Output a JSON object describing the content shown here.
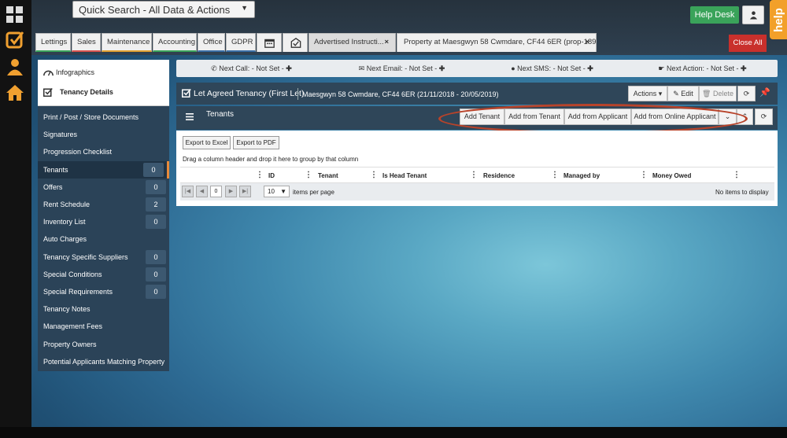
{
  "search": {
    "label": "Quick Search - All Data & Actions"
  },
  "header": {
    "help_desk": "Help Desk",
    "help_tab": "help"
  },
  "tabs": [
    "Lettings",
    "Sales",
    "Maintenance",
    "Accounting",
    "Office",
    "GDPR"
  ],
  "open_docs": [
    {
      "label": "Advertised Instructi..."
    },
    {
      "label": "Property at Maesgwyn 58 Cwmdare, CF44 6ER (prop-189)"
    }
  ],
  "close_all": "Close All",
  "sidebar": {
    "infographics": "Infographics",
    "tenancy_details": "Tenancy Details",
    "items": [
      {
        "label": "Print / Post / Store Documents",
        "count": ""
      },
      {
        "label": "Signatures",
        "count": ""
      },
      {
        "label": "Progression Checklist",
        "count": ""
      },
      {
        "label": "Tenants",
        "count": "0"
      },
      {
        "label": "Offers",
        "count": "0"
      },
      {
        "label": "Rent Schedule",
        "count": "2"
      },
      {
        "label": "Inventory List",
        "count": "0"
      },
      {
        "label": "Auto Charges",
        "count": ""
      },
      {
        "label": "Tenancy Specific Suppliers",
        "count": "0"
      },
      {
        "label": "Special Conditions",
        "count": "0"
      },
      {
        "label": "Special Requirements",
        "count": "0"
      },
      {
        "label": "Tenancy Notes",
        "count": ""
      },
      {
        "label": "Management Fees",
        "count": ""
      },
      {
        "label": "Property Owners",
        "count": ""
      },
      {
        "label": "Potential Applicants Matching Property",
        "count": ""
      }
    ]
  },
  "nextbar": {
    "call": "Next Call: - Not Set -",
    "email": "Next Email: - Not Set -",
    "sms": "Next SMS: - Not Set -",
    "action": "Next Action: - Not Set -"
  },
  "panel": {
    "title": "Let Agreed Tenancy (First Let)",
    "subtitle": "Maesgwyn 58 Cwmdare, CF44 6ER (21/11/2018 - 20/05/2019)",
    "actions": "Actions",
    "edit": "Edit",
    "delete": "Delete"
  },
  "tenants": {
    "title": "Tenants",
    "add_tenant": "Add Tenant",
    "add_from_tenant": "Add from Tenant",
    "add_from_applicant": "Add from Applicant",
    "add_from_online_applicant": "Add from Online Applicant",
    "export_excel": "Export to Excel",
    "export_pdf": "Export to PDF",
    "drag_hint": "Drag a column header and drop it here to group by that column",
    "columns": [
      "ID",
      "Tenant",
      "Is Head Tenant",
      "Residence",
      "Managed by",
      "Money Owed"
    ],
    "page": "0",
    "page_size": "10",
    "items_per_page": "items per page",
    "no_items": "No items to display"
  }
}
